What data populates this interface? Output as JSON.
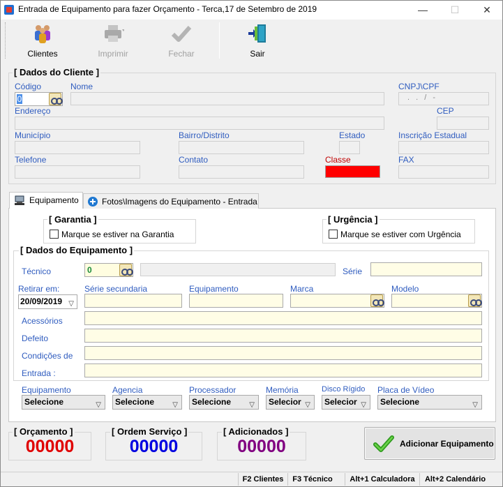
{
  "window": {
    "title": "Entrada de Equipamento para fazer Orçamento - Terca,17 de Setembro de 2019",
    "minimize": "—",
    "maximize": "☐",
    "close": "✕"
  },
  "toolbar": {
    "clientes": "Clientes",
    "imprimir": "Imprimir",
    "fechar": "Fechar",
    "sair": "Sair"
  },
  "cliente": {
    "group_title": "[ Dados do Cliente ]",
    "codigo_label": "Código",
    "codigo_value": "0",
    "nome_label": "Nome",
    "cnpj_label": "CNPJ\\CPF",
    "cnpj_mask": ". . / -",
    "endereco_label": "Endereço",
    "cep_label": "CEP",
    "municipio_label": "Município",
    "bairro_label": "Bairro/Distrito",
    "estado_label": "Estado",
    "inscricao_label": "Inscrição Estadual",
    "telefone_label": "Telefone",
    "contato_label": "Contato",
    "classe_label": "Classe",
    "classe_color": "#ff0000",
    "fax_label": "FAX"
  },
  "tabs": [
    {
      "label": "Equipamento",
      "icon": "equipment-icon"
    },
    {
      "label": "Fotos\\Imagens do Equipamento - Entrada",
      "icon": "plus-circle-icon"
    }
  ],
  "garantia": {
    "title": "[ Garantia ]",
    "checkbox_label": "Marque se estiver na Garantia"
  },
  "urgencia": {
    "title": "[ Urgência ]",
    "checkbox_label": "Marque se estiver com Urgência"
  },
  "equipamento": {
    "group_title": "[ Dados do Equipamento ]",
    "tecnico_label": "Técnico",
    "tecnico_value": "0",
    "serie_label": "Série",
    "retirar_label": "Retirar em:",
    "retirar_value": "20/09/2019",
    "serie_sec_label": "Série secundaria",
    "equipamento_label": "Equipamento",
    "marca_label": "Marca",
    "modelo_label": "Modelo",
    "acessorios_label": "Acessórios",
    "defeito_label": "Defeito",
    "condicoes_label": "Condições de",
    "entrada_label": "Entrada :"
  },
  "selects": [
    {
      "label": "Equipamento",
      "value": "Selecione"
    },
    {
      "label": "Agencia",
      "value": "Selecione"
    },
    {
      "label": "Processador",
      "value": "Selecione"
    },
    {
      "label": "Memória",
      "value": "Selecior"
    },
    {
      "label": "Disco Rígido",
      "value": "Selecior"
    },
    {
      "label": "Placa de Vídeo",
      "value": "Selecione"
    }
  ],
  "counters": {
    "orcamento_label": "[ Orçamento ]",
    "orcamento_value": "00000",
    "orcamento_color": "#e00000",
    "ordem_label": "[ Ordem Serviço ]",
    "ordem_value": "00000",
    "ordem_color": "#0000e0",
    "adicionados_label": "[ Adicionados ]",
    "adicionados_value": "00000",
    "adicionados_color": "#800080"
  },
  "add_button": "Adicionar Equipamento",
  "status": {
    "f2": "F2 Clientes",
    "f3": "F3 Técnico",
    "alt1": "Alt+1 Calculadora",
    "alt2": "Alt+2 Calendário"
  }
}
